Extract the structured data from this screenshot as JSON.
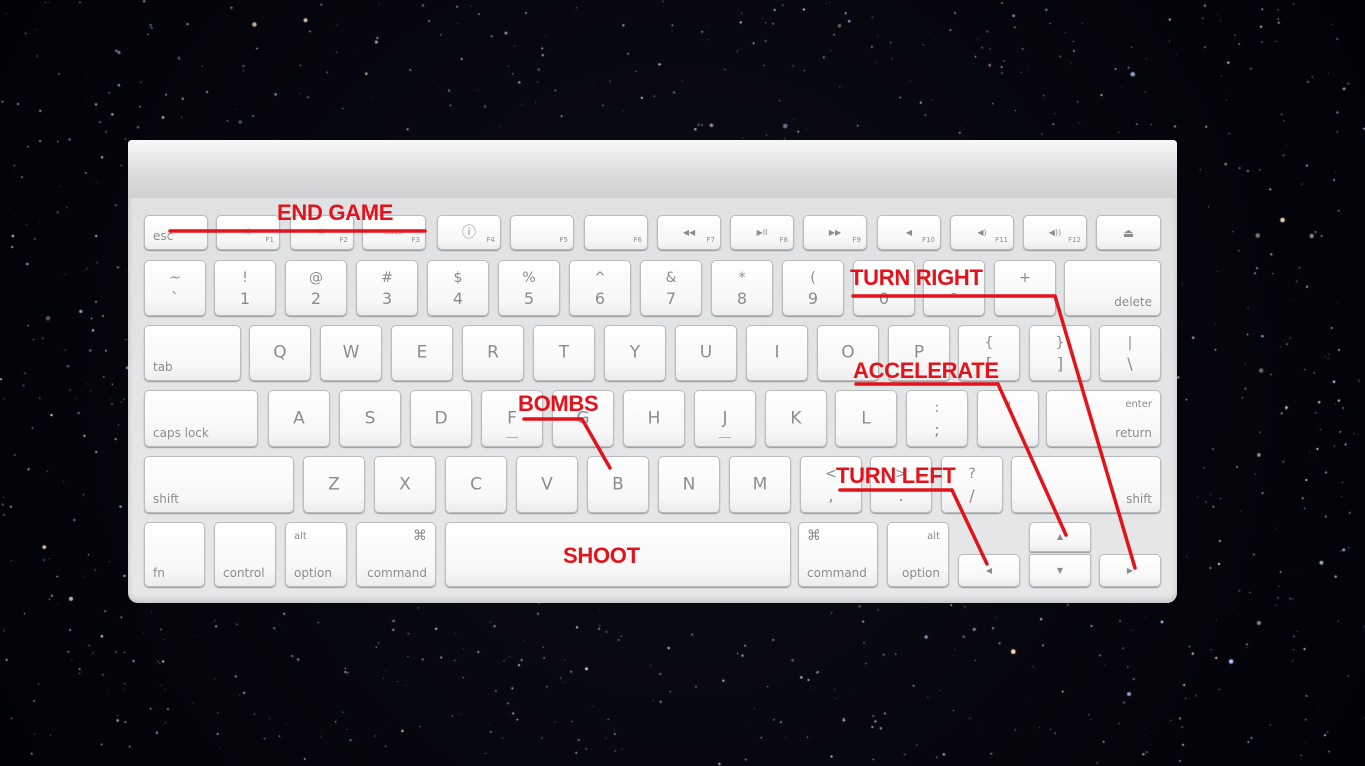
{
  "annotations": {
    "end_game": "END GAME",
    "turn_right": "TURN RIGHT",
    "accelerate": "ACCELERATE",
    "bombs": "BOMBS",
    "turn_left": "TURN LEFT",
    "shoot": "SHOOT"
  },
  "annotation_color": "#e3131b",
  "keys": {
    "esc": "esc",
    "f1": "F1",
    "f2": "F2",
    "f3": "F3",
    "f4": "F4",
    "f5": "F5",
    "f6": "F6",
    "f7": "F7",
    "f8": "F8",
    "f9": "F9",
    "f10": "F10",
    "f11": "F11",
    "f12": "F12",
    "f1_icon": "☼",
    "f2_icon": "☀",
    "f3_icon": "▭▭",
    "f4_icon": "ⓘ",
    "f7_icon": "◀◀",
    "f8_icon": "▶II",
    "f9_icon": "▶▶",
    "f10_icon": "◀",
    "f11_icon": "◀)",
    "f12_icon": "◀))",
    "eject_icon": "⏏",
    "tilde_top": "~",
    "tilde_bot": "`",
    "n1_top": "!",
    "n1": "1",
    "n2_top": "@",
    "n2": "2",
    "n3_top": "#",
    "n3": "3",
    "n4_top": "$",
    "n4": "4",
    "n5_top": "%",
    "n5": "5",
    "n6_top": "^",
    "n6": "6",
    "n7_top": "&",
    "n7": "7",
    "n8_top": "*",
    "n8": "8",
    "n9_top": "(",
    "n9": "9",
    "n0": "0",
    "minus": "–",
    "equals_top": "+",
    "delete": "delete",
    "tab": "tab",
    "q": "Q",
    "w": "W",
    "e": "E",
    "r": "R",
    "t": "T",
    "y": "Y",
    "u": "U",
    "i": "I",
    "o": "O",
    "p": "P",
    "lbracket_top": "{",
    "lbracket": "[",
    "rbracket_top": "}",
    "rbracket": "]",
    "pipe_top": "|",
    "backslash": "\\",
    "caps_lock": "caps lock",
    "a": "A",
    "s": "S",
    "d": "D",
    "f": "F",
    "g": "G",
    "h": "H",
    "j": "J",
    "k": "K",
    "l": "L",
    "colon_top": ":",
    "semicolon": ";",
    "quote_top": "\"",
    "enter": "enter",
    "return": "return",
    "shift": "shift",
    "z": "Z",
    "x": "X",
    "c": "C",
    "v": "V",
    "b": "B",
    "n": "N",
    "m": "M",
    "comma_top": "<",
    "comma": ",",
    "period_top": ">",
    "period": ".",
    "question_top": "?",
    "slash": "/",
    "fn": "fn",
    "control": "control",
    "alt": "alt",
    "option": "option",
    "command_symbol": "⌘",
    "command": "command",
    "arrow_left": "◀",
    "arrow_up": "▲",
    "arrow_down": "▼",
    "arrow_right": "▶"
  }
}
